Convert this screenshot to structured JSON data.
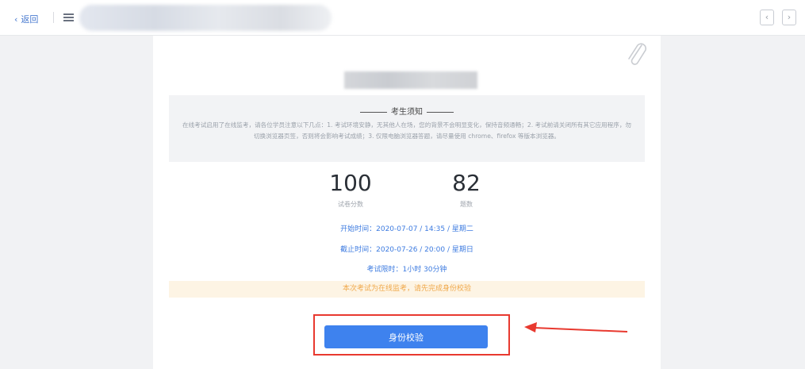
{
  "topbar": {
    "back_label": "返回",
    "title_blurred": ""
  },
  "notice": {
    "title": "考生须知",
    "body": "在线考试启用了在线监考，请各位学员注意以下几点：1. 考试环境安静，无其他人在场，您的背景不会明显变化，保持音频通畅；2. 考试前请关闭所有其它应用程序，勿切换浏览器页签，否则将会影响考试成绩；3. 仅限电脑浏览器答题，请尽量使用 chrome、firefox 等版本浏览器。"
  },
  "stats": {
    "score": {
      "value": "100",
      "label": "试卷分数"
    },
    "questions": {
      "value": "82",
      "label": "题数"
    }
  },
  "schedule": {
    "start_label": "开始时间：",
    "start_value": "2020-07-07 / 14:35 / 星期二",
    "end_label": "截止时间：",
    "end_value": "2020-07-26 / 20:00 / 星期日",
    "limit_label": "考试限时：",
    "limit_value": "1小时 30分钟"
  },
  "warning": "本次考试为在线监考，请先完成身份校验",
  "verify_button": "身份校验",
  "colors": {
    "accent": "#3e82ee",
    "link": "#3d7be0",
    "warn_bg": "#fdf4e4",
    "warn_text": "#f0a84a",
    "annotation": "#e8392f"
  },
  "icons": [
    "chevron-left-icon",
    "menu-icon",
    "paperclip-icon",
    "prev-page-icon",
    "next-page-icon",
    "arrow-annotation-icon"
  ]
}
